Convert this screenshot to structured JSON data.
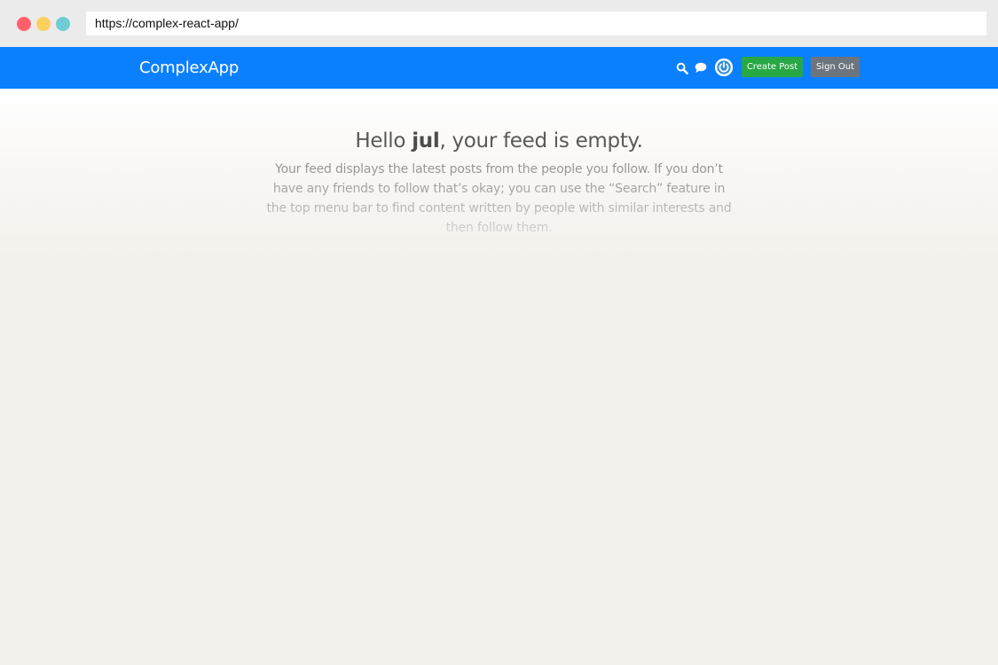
{
  "browser": {
    "url": "https://complex-react-app/",
    "dots": {
      "red": "#ff5f6d",
      "yellow": "#ffd15c",
      "teal": "#6fccd4"
    }
  },
  "header": {
    "brand": "ComplexApp",
    "color": "#0b80ff",
    "icons": {
      "search": "search-icon",
      "chat": "chat-icon",
      "avatar": "avatar-power-icon"
    },
    "create_post_label": "Create Post",
    "sign_out_label": "Sign Out",
    "create_post_color": "#28a745",
    "sign_out_color": "#6c757d"
  },
  "main": {
    "greeting_prefix": "Hello ",
    "username": "jul",
    "greeting_suffix": ", your feed is empty.",
    "description": "Your feed displays the latest posts from the people you follow. If you don’t have any friends to follow that’s okay; you can use the “Search” feature in the top menu bar to find content written by people with similar interests and then follow them."
  }
}
